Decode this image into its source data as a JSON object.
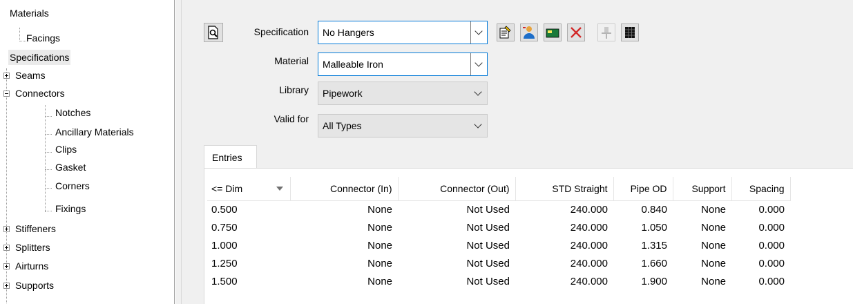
{
  "tree": {
    "nodes": [
      {
        "label": "Materials"
      },
      {
        "label": "Facings"
      },
      {
        "label": "Specifications"
      },
      {
        "label": "Seams"
      },
      {
        "label": "Connectors"
      },
      {
        "label": "Notches"
      },
      {
        "label": "Ancillary Materials"
      },
      {
        "label": "Clips"
      },
      {
        "label": "Gasket"
      },
      {
        "label": "Corners"
      },
      {
        "label": "Fixings"
      },
      {
        "label": "Stiffeners"
      },
      {
        "label": "Splitters"
      },
      {
        "label": "Airturns"
      },
      {
        "label": "Supports"
      }
    ],
    "selected": "Specifications"
  },
  "form": {
    "specification_label": "Specification",
    "specification_value": "No Hangers",
    "material_label": "Material",
    "material_value": "Malleable Iron",
    "library_label": "Library",
    "library_value": "Pipework",
    "valid_for_label": "Valid for",
    "valid_for_value": "All Types"
  },
  "toolbar": {
    "icons": [
      "preview-icon",
      "properties-icon",
      "user-icon",
      "new-icon",
      "delete-icon",
      "pin-icon",
      "grid-icon"
    ]
  },
  "tab": {
    "label": "Entries"
  },
  "grid": {
    "columns": [
      "<= Dim",
      "Connector (In)",
      "Connector (Out)",
      "STD Straight",
      "Pipe OD",
      "Support",
      "Spacing"
    ],
    "rows": [
      [
        "0.500",
        "None",
        "Not Used",
        "240.000",
        "0.840",
        "None",
        "0.000"
      ],
      [
        "0.750",
        "None",
        "Not Used",
        "240.000",
        "1.050",
        "None",
        "0.000"
      ],
      [
        "1.000",
        "None",
        "Not Used",
        "240.000",
        "1.315",
        "None",
        "0.000"
      ],
      [
        "1.250",
        "None",
        "Not Used",
        "240.000",
        "1.660",
        "None",
        "0.000"
      ],
      [
        "1.500",
        "None",
        "Not Used",
        "240.000",
        "1.900",
        "None",
        "0.000"
      ]
    ]
  },
  "colors": {
    "accent": "#0078d7",
    "delete": "#d22a2a"
  }
}
